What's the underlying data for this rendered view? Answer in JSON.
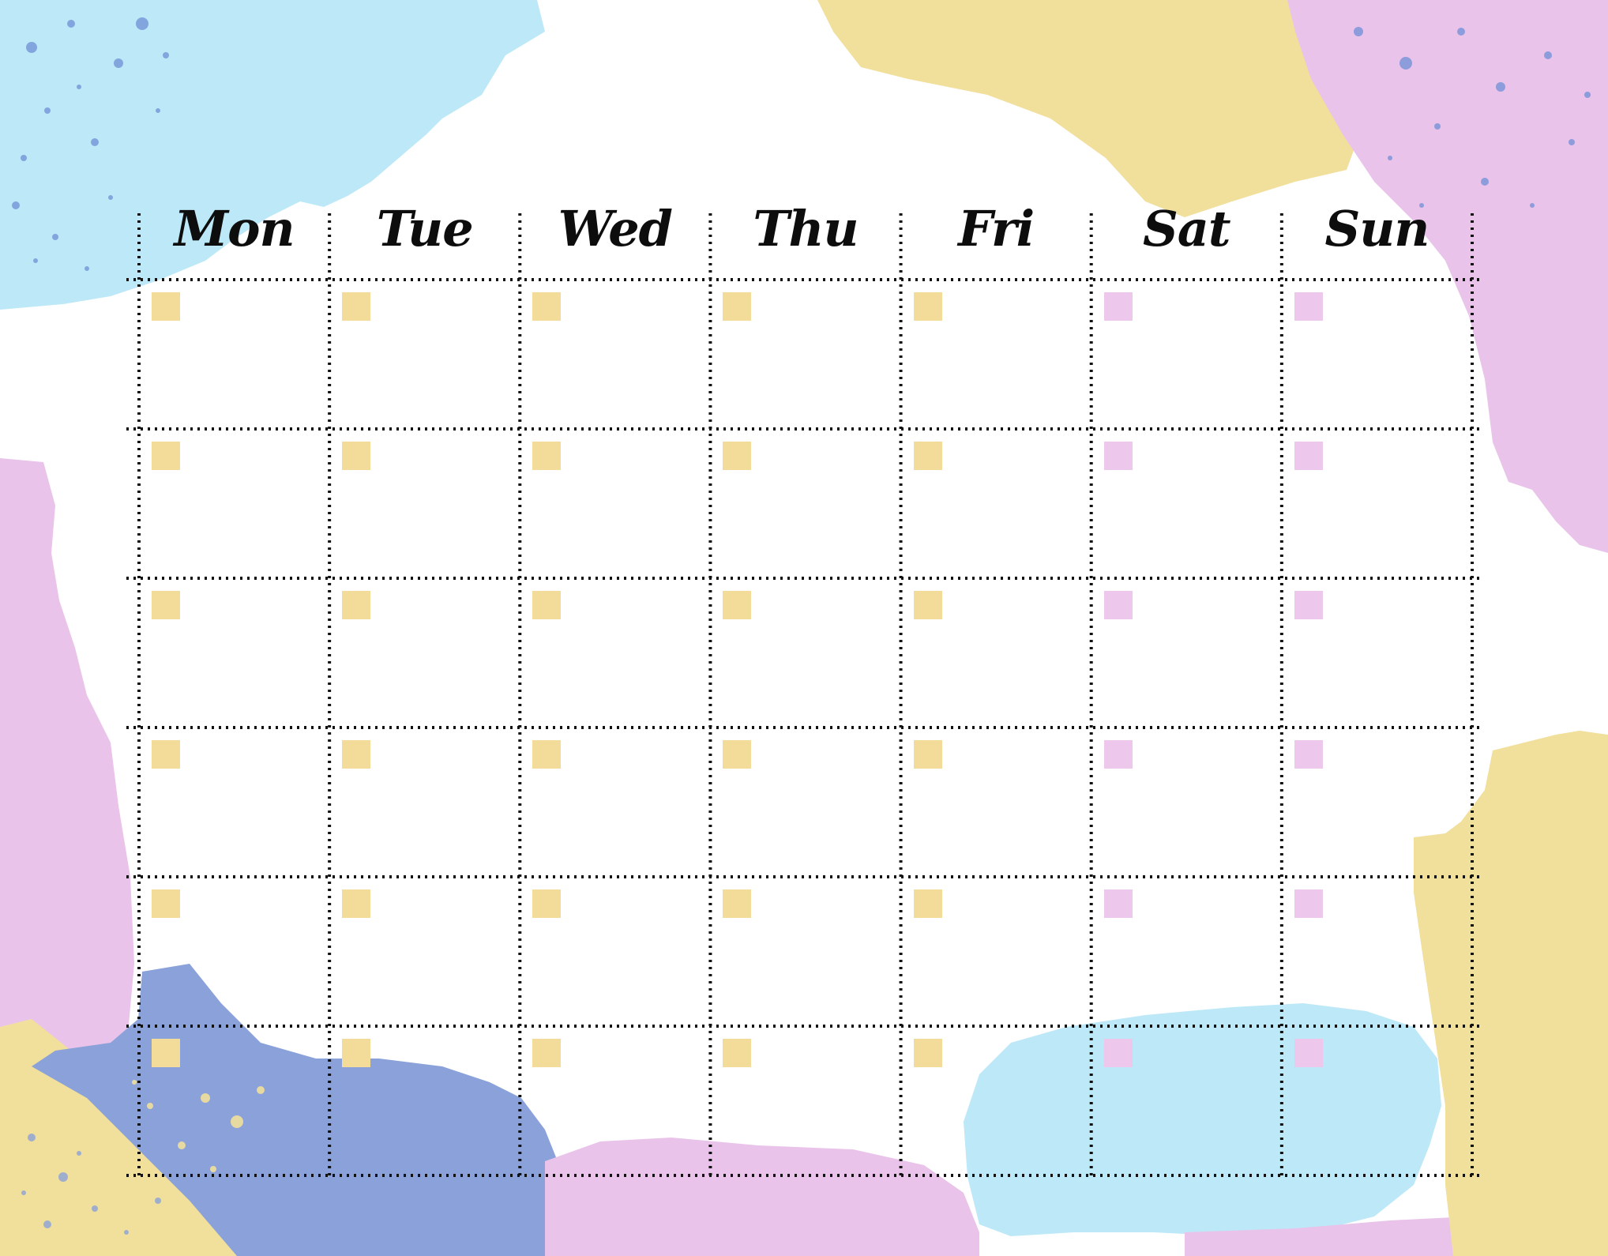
{
  "calendar": {
    "weekdays": [
      "Mon",
      "Tue",
      "Wed",
      "Thu",
      "Fri",
      "Sat",
      "Sun"
    ],
    "week_count": 6,
    "weekday_marker_color": "#f3db9a",
    "weekend_marker_color": "#edc7ec",
    "grid_line_color": "#111111",
    "grid_line_style": "dotted"
  },
  "palette": {
    "light_blue": "#bde8f8",
    "yellow": "#f1df9c",
    "pink": "#e9c3ea",
    "periwinkle": "#8aa2d9",
    "speckle_blue": "#6f8fd6"
  }
}
